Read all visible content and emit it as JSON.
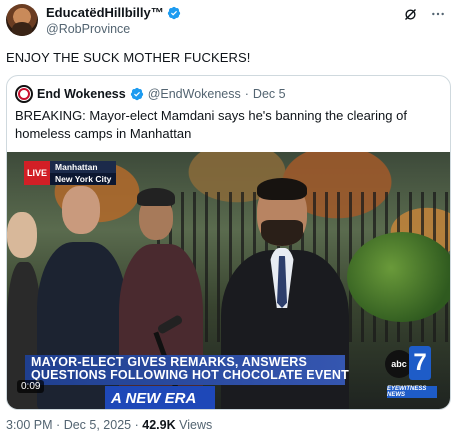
{
  "post": {
    "display_name": "EducatëdHillbilly™",
    "handle": "@RobProvince",
    "text": "ENJOY THE SUCK MOTHER FUCKERS!",
    "time": "3:00 PM",
    "date": "Dec 5, 2025",
    "views_count": "42.9K",
    "views_label": "Views",
    "separator": "·"
  },
  "quote": {
    "display_name": "End Wokeness",
    "handle": "@EndWokeness",
    "date": "Dec 5",
    "separator": "·",
    "text": "BREAKING: Mayor-elect Mamdani says he's banning the clearing of homeless camps in Manhattan"
  },
  "video": {
    "live_label": "LIVE",
    "location_line1": "Manhattan",
    "location_line2": "New York City",
    "headline": "MAYOR-ELECT GIVES REMARKS, ANSWERS QUESTIONS FOLLOWING HOT CHOCOLATE EVENT",
    "banner_text": "A NEW ERA",
    "duration": "0:09",
    "station_abc": "abc",
    "station_number": "7",
    "station_tagline": "EYEWITNESS NEWS"
  },
  "icons": [
    "grok-icon",
    "more-icon",
    "verified-badge-icon",
    "avatar"
  ],
  "colors": {
    "verified": "#1d9bf0",
    "live_red": "#d21f26",
    "abc_blue": "#1e5cc8",
    "muted": "#536471"
  }
}
